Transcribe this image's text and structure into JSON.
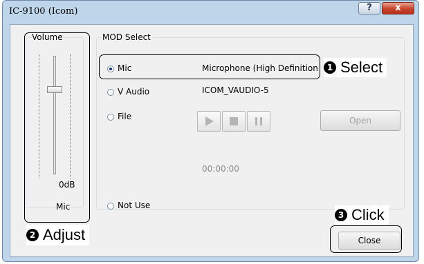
{
  "window": {
    "title": "IC-9100 (Icom)",
    "help_label": "?",
    "close_label": "x"
  },
  "volume": {
    "group_label": "Volume",
    "level_label": "0dB",
    "source_label": "Mic"
  },
  "mod_select": {
    "group_label": "MOD Select",
    "options": [
      {
        "label": "Mic",
        "selected": true,
        "device": "Microphone (High Definition"
      },
      {
        "label": "V Audio",
        "selected": false,
        "device": "ICOM_VAUDIO-5"
      },
      {
        "label": "File",
        "selected": false,
        "device": ""
      },
      {
        "label": "Not Use",
        "selected": false,
        "device": ""
      }
    ],
    "timer": "00:00:00",
    "open_label": "Open"
  },
  "close_button": {
    "label": "Close"
  },
  "callouts": {
    "select": {
      "badge": "1",
      "text": "Select"
    },
    "adjust": {
      "badge": "2",
      "text": "Adjust"
    },
    "click": {
      "badge": "3",
      "text": "Click"
    }
  },
  "colors": {
    "frame": "#bfd6ea",
    "client": "#f0f0f0",
    "close_red": "#c6442c"
  }
}
